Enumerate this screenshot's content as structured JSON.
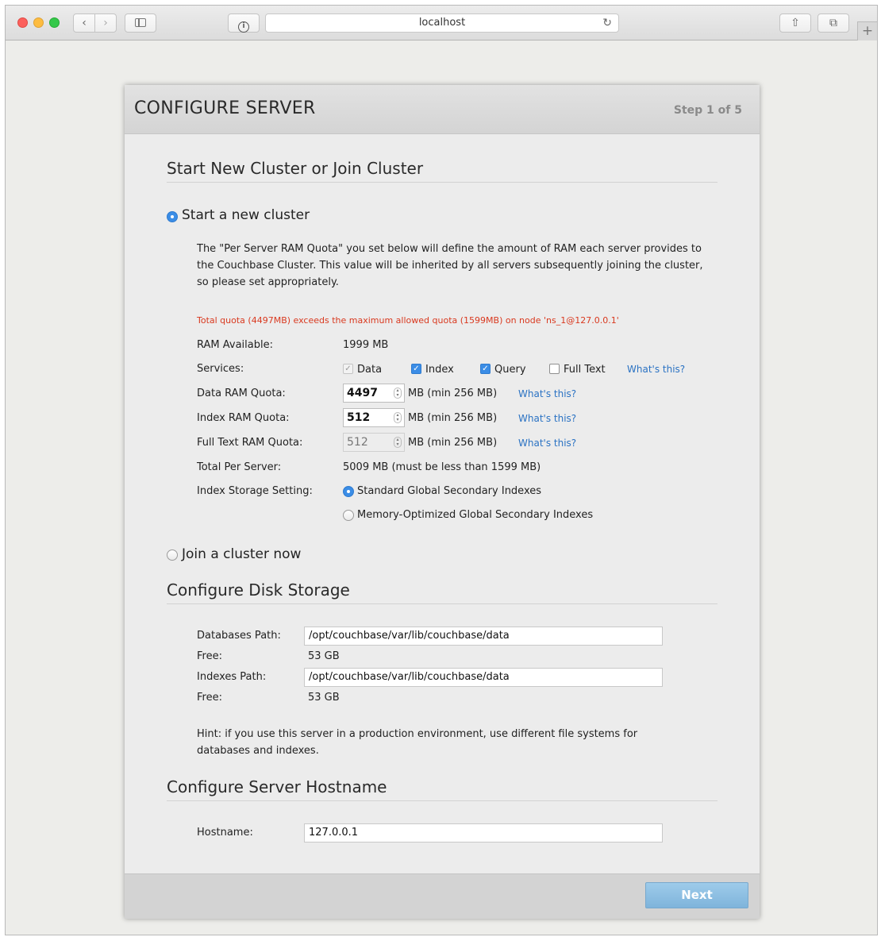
{
  "browser": {
    "address": "localhost",
    "back": "‹",
    "forward": "›",
    "reload": "↻",
    "newtab": "+",
    "share": "⇧",
    "tabs": "⧉"
  },
  "dialog": {
    "title": "CONFIGURE SERVER",
    "step": "Step 1 of 5",
    "next_label": "Next"
  },
  "cluster": {
    "section_title": "Start New Cluster or Join Cluster",
    "start_new_label": "Start a new cluster",
    "description": "The \"Per Server RAM Quota\" you set below will define the amount of RAM each server provides to the Couchbase Cluster. This value will be inherited by all servers subsequently joining the cluster, so please set appropriately.",
    "error": "Total quota (4497MB) exceeds the maximum allowed quota (1599MB) on node 'ns_1@127.0.0.1'",
    "ram_available_label": "RAM Available:",
    "ram_available_value": "1999 MB",
    "services_label": "Services:",
    "services": {
      "data": "Data",
      "index": "Index",
      "query": "Query",
      "fulltext": "Full Text"
    },
    "whats_this": "What's this?",
    "data_quota_label": "Data RAM Quota:",
    "data_quota_value": "4497",
    "index_quota_label": "Index RAM Quota:",
    "index_quota_value": "512",
    "fulltext_quota_label": "Full Text RAM Quota:",
    "fulltext_quota_value": "512",
    "quota_unit": "MB (min 256 MB)",
    "total_label": "Total Per Server:",
    "total_value": "5009 MB (must be less than 1599 MB)",
    "index_storage_label": "Index Storage Setting:",
    "index_storage_standard": "Standard Global Secondary Indexes",
    "index_storage_memopt": "Memory-Optimized Global Secondary Indexes",
    "join_label": "Join a cluster now"
  },
  "disk": {
    "section_title": "Configure Disk Storage",
    "db_path_label": "Databases Path:",
    "db_path_value": "/opt/couchbase/var/lib/couchbase/data",
    "db_free_label": "Free:",
    "db_free_value": "53 GB",
    "idx_path_label": "Indexes Path:",
    "idx_path_value": "/opt/couchbase/var/lib/couchbase/data",
    "idx_free_label": "Free:",
    "idx_free_value": "53 GB",
    "hint": "Hint: if you use this server in a production environment, use different file systems for databases and indexes."
  },
  "hostname": {
    "section_title": "Configure Server Hostname",
    "label": "Hostname:",
    "value": "127.0.0.1"
  }
}
